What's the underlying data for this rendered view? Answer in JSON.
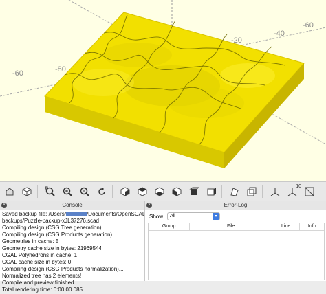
{
  "viewport": {
    "background": "#ffffe5",
    "model_color": "#f2e000",
    "axis_labels": [
      "-60",
      "-80",
      "-20",
      "-40",
      "-60"
    ]
  },
  "toolbar": {
    "icons": [
      "preview-icon",
      "render-icon",
      "zoom-all-icon",
      "zoom-in-icon",
      "zoom-out-icon",
      "reset-view-icon",
      "view-right-icon",
      "view-top-icon",
      "view-bottom-icon",
      "view-left-icon",
      "view-front-icon",
      "view-back-icon",
      "view-diagonal-icon",
      "view-center-icon",
      "perspective-icon",
      "orthogonal-icon",
      "show-axes-icon",
      "show-scale-markers-icon",
      "show-edges-icon"
    ],
    "scale_marker_text": "10"
  },
  "console": {
    "title": "Console",
    "lines": [
      "Saved backup file: /Users/",
      "backups/Puzzle-backup-xJL37276.scad",
      "Compiling design (CSG Tree generation)...",
      "Compiling design (CSG Products generation)...",
      "Geometries in cache: 5",
      "Geometry cache size in bytes: 21969544",
      "CGAL Polyhedrons in cache: 1",
      "CGAL cache size in bytes: 0",
      "Compiling design (CSG Products normalization)...",
      "Normalized tree has 2 elements!",
      "Compile and preview finished.",
      "Total rendering time: 0:00:00.085"
    ],
    "line1_suffix": "/Documents/OpenSCAD/"
  },
  "errorlog": {
    "title": "Error-Log",
    "show_label": "Show",
    "filter_value": "All",
    "columns": [
      "Group",
      "File",
      "Line",
      "Info"
    ]
  }
}
